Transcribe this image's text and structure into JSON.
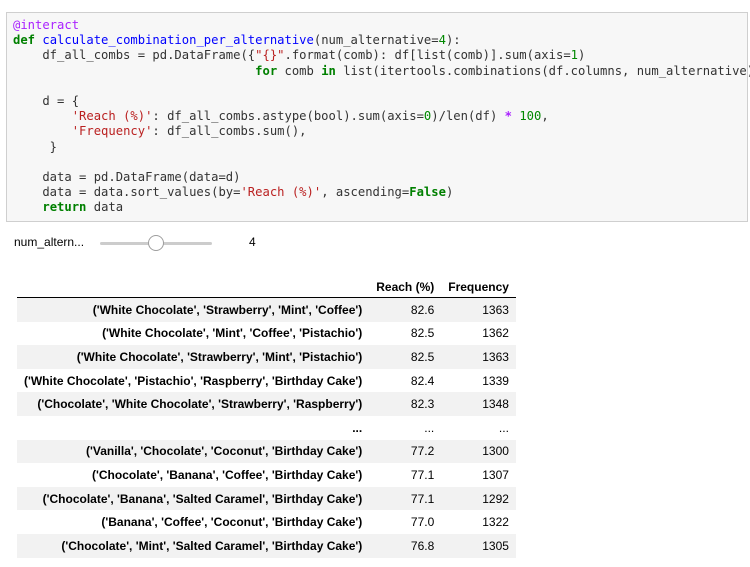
{
  "cell": {
    "decorator": "@interact",
    "kw_def": "def",
    "func_name": "calculate_combination_per_alternative",
    "sig_open": "(num_alternative=",
    "sig_num": "4",
    "sig_close": "):",
    "l2_a": "    df_all_combs = pd.DataFrame({",
    "l2_str": "\"{}\"",
    "l2_b": ".format(comb): df[list(comb)].sum(axis=",
    "l2_num": "1",
    "l2_c": ")",
    "l3_indent": "                                 ",
    "kw_for": "for",
    "l3_a": " comb ",
    "kw_in": "in",
    "l3_b": " list(itertools.combinations(df.columns, num_alternative))})",
    "l4": "",
    "l5": "    d = {",
    "l6_indent": "        ",
    "l6_str": "'Reach (%)'",
    "l6_a": ": df_all_combs.astype(bool).sum(axis=",
    "l6_num": "0",
    "l6_b": ")/len(df) ",
    "l6_op": "*",
    "l6_sp": " ",
    "l6_num2": "100",
    "l6_c": ",",
    "l7_indent": "        ",
    "l7_str": "'Frequency'",
    "l7_a": ": df_all_combs.sum(),",
    "l8": "     }",
    "l9": "",
    "l10": "    data = pd.DataFrame(data=d)",
    "l11_a": "    data = data.sort_values(by=",
    "l11_str": "'Reach (%)'",
    "l11_b": ", ascending=",
    "kw_false": "False",
    "l11_c": ")",
    "l12_indent": "    ",
    "kw_return": "return",
    "l12_a": " data"
  },
  "widget": {
    "label": "num_altern...",
    "value": "4",
    "slider_fraction": 0.5
  },
  "table": {
    "columns": [
      "Reach (%)",
      "Frequency"
    ],
    "rows": [
      {
        "index": "('White Chocolate', 'Strawberry', 'Mint', 'Coffee')",
        "reach": "82.6",
        "freq": "1363"
      },
      {
        "index": "('White Chocolate', 'Mint', 'Coffee', 'Pistachio')",
        "reach": "82.5",
        "freq": "1362"
      },
      {
        "index": "('White Chocolate', 'Strawberry', 'Mint', 'Pistachio')",
        "reach": "82.5",
        "freq": "1363"
      },
      {
        "index": "('White Chocolate', 'Pistachio', 'Raspberry', 'Birthday Cake')",
        "reach": "82.4",
        "freq": "1339"
      },
      {
        "index": "('Chocolate', 'White Chocolate', 'Strawberry', 'Raspberry')",
        "reach": "82.3",
        "freq": "1348"
      },
      {
        "index": "...",
        "reach": "...",
        "freq": "..."
      },
      {
        "index": "('Vanilla', 'Chocolate', 'Coconut', 'Birthday Cake')",
        "reach": "77.2",
        "freq": "1300"
      },
      {
        "index": "('Chocolate', 'Banana', 'Coffee', 'Birthday Cake')",
        "reach": "77.1",
        "freq": "1307"
      },
      {
        "index": "('Chocolate', 'Banana', 'Salted Caramel', 'Birthday Cake')",
        "reach": "77.1",
        "freq": "1292"
      },
      {
        "index": "('Banana', 'Coffee', 'Coconut', 'Birthday Cake')",
        "reach": "77.0",
        "freq": "1322"
      },
      {
        "index": "('Chocolate', 'Mint', 'Salted Caramel', 'Birthday Cake')",
        "reach": "76.8",
        "freq": "1305"
      }
    ]
  }
}
